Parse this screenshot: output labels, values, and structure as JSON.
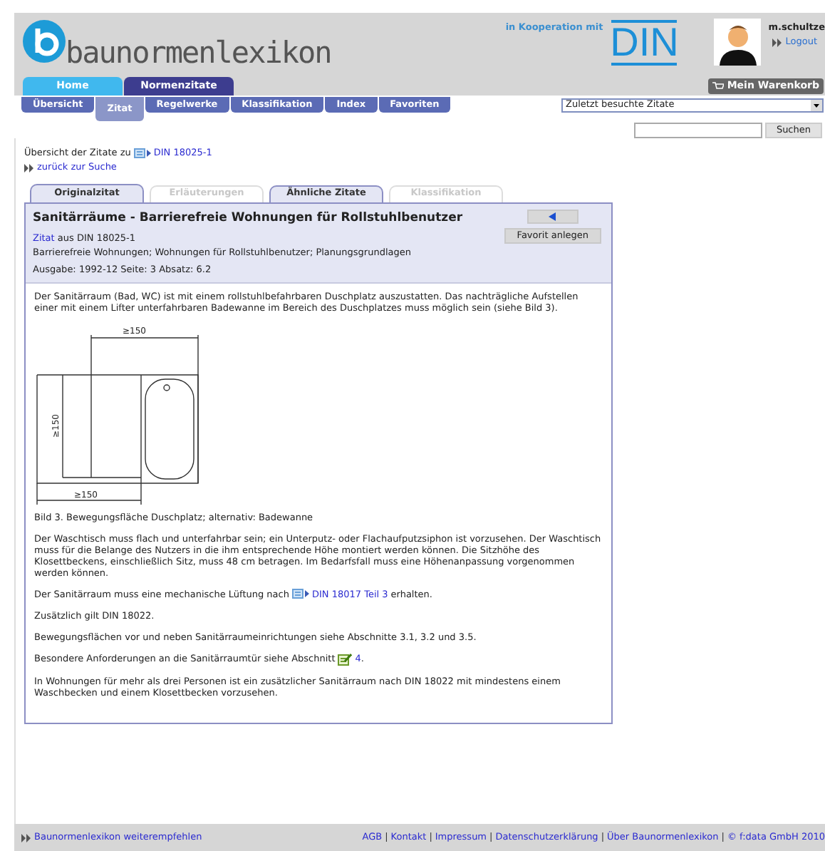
{
  "header": {
    "logo_text": "baunormenlexikon",
    "partner_label": "in Kooperation mit",
    "partner_logo": "DIN",
    "user": {
      "name": "m.schultze",
      "logout": "Logout"
    },
    "cart_button": "Mein Warenkorb"
  },
  "main_nav": [
    {
      "label": "Home",
      "selected": false
    },
    {
      "label": "Normenzitate",
      "selected": true
    }
  ],
  "sub_nav": [
    {
      "label": "Übersicht",
      "selected": false
    },
    {
      "label": "Zitat",
      "selected": true
    },
    {
      "label": "Regelwerke",
      "selected": false
    },
    {
      "label": "Klassifikation",
      "selected": false
    },
    {
      "label": "Index",
      "selected": false
    },
    {
      "label": "Favoriten",
      "selected": false
    }
  ],
  "recent_select": {
    "value": "Zuletzt besuchte Zitate"
  },
  "search": {
    "button": "Suchen"
  },
  "breadcrumb": {
    "text": "Übersicht der Zitate zu",
    "link": "DIN 18025-1",
    "back": "zurück zur Suche"
  },
  "tabs": [
    {
      "label": "Originalzitat",
      "selected": true,
      "disabled": false
    },
    {
      "label": "Erläuterungen",
      "selected": false,
      "disabled": true
    },
    {
      "label": "Ähnliche Zitate",
      "selected": false,
      "disabled": false
    },
    {
      "label": "Klassifikation",
      "selected": false,
      "disabled": true
    }
  ],
  "citation": {
    "title": "Sanitärräume - Barrierefreie Wohnungen für Rollstuhlbenutzer",
    "source_link": "Zitat",
    "source_text": "aus DIN 18025-1",
    "keywords": "Barrierefreie Wohnungen; Wohnungen für Rollstuhlbenutzer; Planungsgrundlagen",
    "edition": "Ausgabe: 1992-12 Seite: 3 Absatz: 6.2",
    "favorite_button": "Favorit anlegen"
  },
  "paragraphs": [
    {
      "kind": "text",
      "text": "Der Sanitärraum (Bad, WC) ist mit einem rollstuhlbefahrbaren Duschplatz auszustatten. Das nachträgliche Aufstellen einer mit einem Lifter unterfahrbaren Badewanne im Bereich des Duschplatzes muss möglich sein (siehe Bild 3)."
    },
    {
      "kind": "figure",
      "labels": [
        "≥150",
        "≥150",
        "≥150"
      ]
    },
    {
      "kind": "text",
      "text": "Bild 3. Bewegungsfläche Duschplatz; alternativ: Badewanne"
    },
    {
      "kind": "text",
      "text": "Der Waschtisch muss flach und unterfahrbar sein; ein Unterputz- oder Flachaufputzsiphon ist vorzusehen. Der Waschtisch muss für die Belange des Nutzers in die ihm entsprechende Höhe montiert werden können. Die Sitzhöhe des Klosettbeckens, einschließlich Sitz, muss 48 cm betragen. Im Bedarfsfall muss eine Höhenanpassung vorgenommen werden können."
    },
    {
      "kind": "norm_ref",
      "before": "Der Sanitärraum muss eine mechanische Lüftung nach",
      "link": "DIN 18017 Teil 3",
      "after": "erhalten."
    },
    {
      "kind": "text",
      "text": "Zusätzlich gilt DIN 18022."
    },
    {
      "kind": "text",
      "text": "Bewegungsflächen vor und neben Sanitärraumeinrichtungen siehe Abschnitte 3.1, 3.2 und 3.5."
    },
    {
      "kind": "section_ref",
      "before": "Besondere Anforderungen an die Sanitärraumtür siehe Abschnitt",
      "link": "4",
      "after": "."
    },
    {
      "kind": "text",
      "text": "In Wohnungen für mehr als drei Personen ist ein zusätzlicher Sanitärraum nach DIN 18022 mit mindestens einem Waschbecken und einem Klosettbecken vorzusehen."
    }
  ],
  "footer": {
    "recommend": "Baunormenlexikon weiterempfehlen",
    "separator": "|",
    "links": [
      "AGB",
      "Kontakt",
      "Impressum",
      "Datenschutzerklärung",
      "Über Baunormenlexikon",
      "© f:data GmbH 2010"
    ]
  }
}
